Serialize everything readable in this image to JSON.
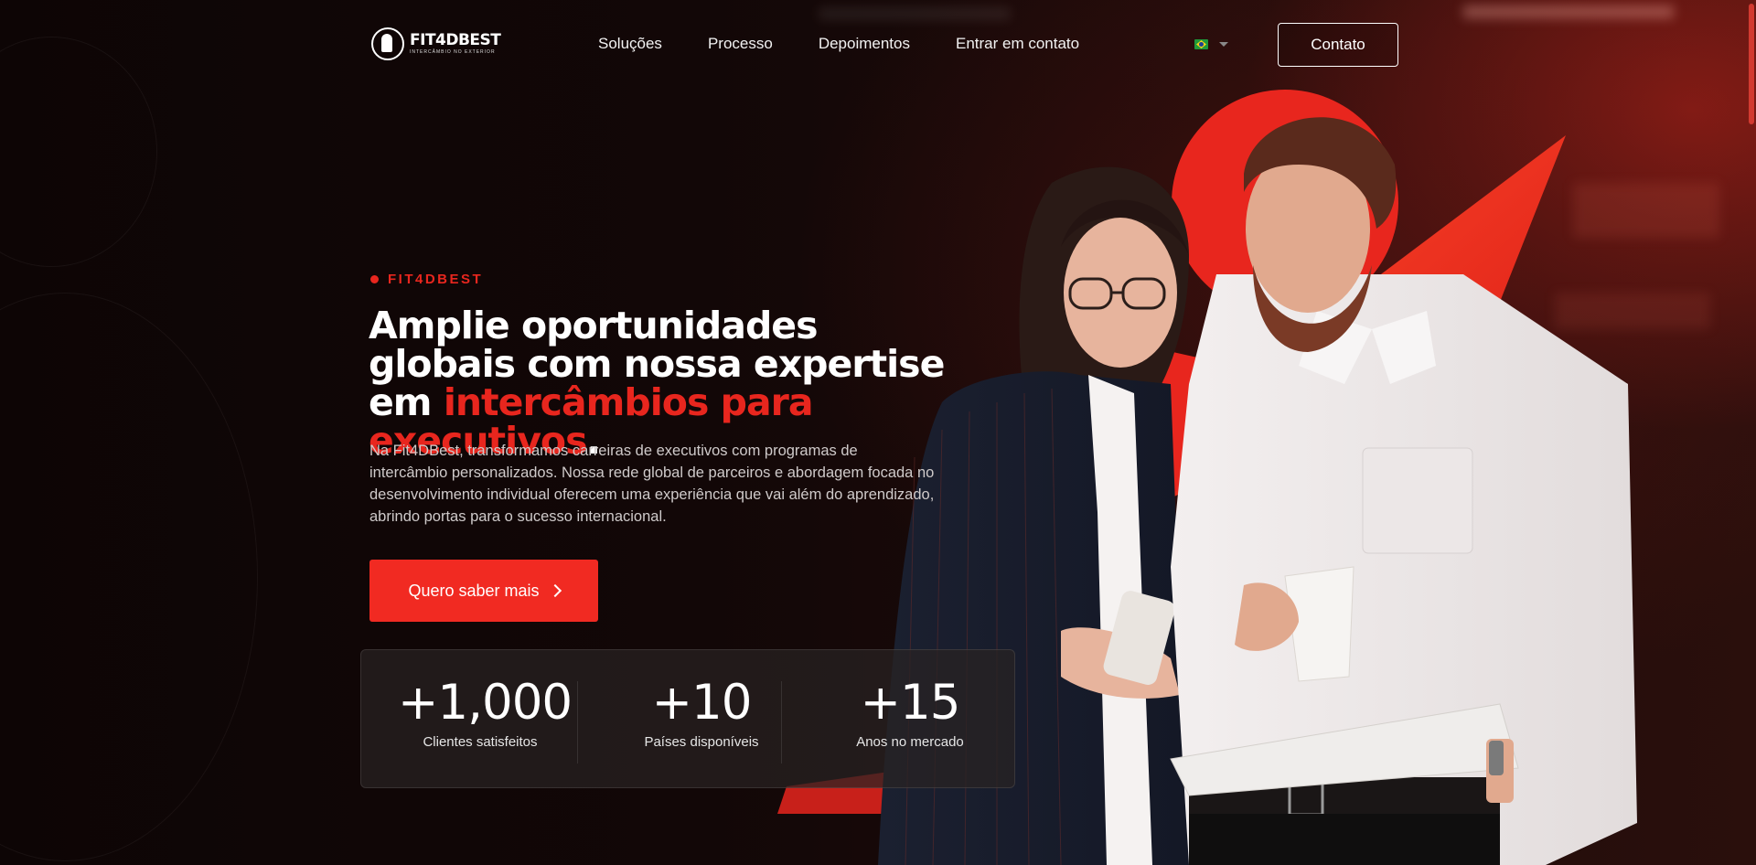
{
  "brand": {
    "name": "FIT4DBEST",
    "tagline": "INTERCÂMBIO NO EXTERIOR",
    "accent_color": "#e8261e"
  },
  "nav": {
    "items": [
      {
        "label": "Soluções"
      },
      {
        "label": "Processo"
      },
      {
        "label": "Depoimentos"
      },
      {
        "label": "Entrar em contato"
      }
    ],
    "language_icon": "brazil-flag-icon",
    "contact_button": "Contato"
  },
  "hero": {
    "eyebrow": "FIT4DBEST",
    "headline_part1": "Amplie oportunidades globais com nossa expertise em ",
    "headline_accent": "intercâmbios para executivos",
    "headline_end": ".",
    "description": "Na Fit4DBest, transformamos carreiras de executivos com programas de intercâmbio personalizados. Nossa rede global de parceiros e abordagem focada no desenvolvimento individual oferecem uma experiência que vai além do aprendizado, abrindo portas para o sucesso internacional.",
    "cta_label": "Quero saber mais",
    "cta_icon": "chevron-right-icon"
  },
  "stats": [
    {
      "value": "+1,000",
      "label": "Clientes satisfeitos"
    },
    {
      "value": "+10",
      "label": "Países disponíveis"
    },
    {
      "value": "+15",
      "label": "Anos no mercado"
    }
  ]
}
